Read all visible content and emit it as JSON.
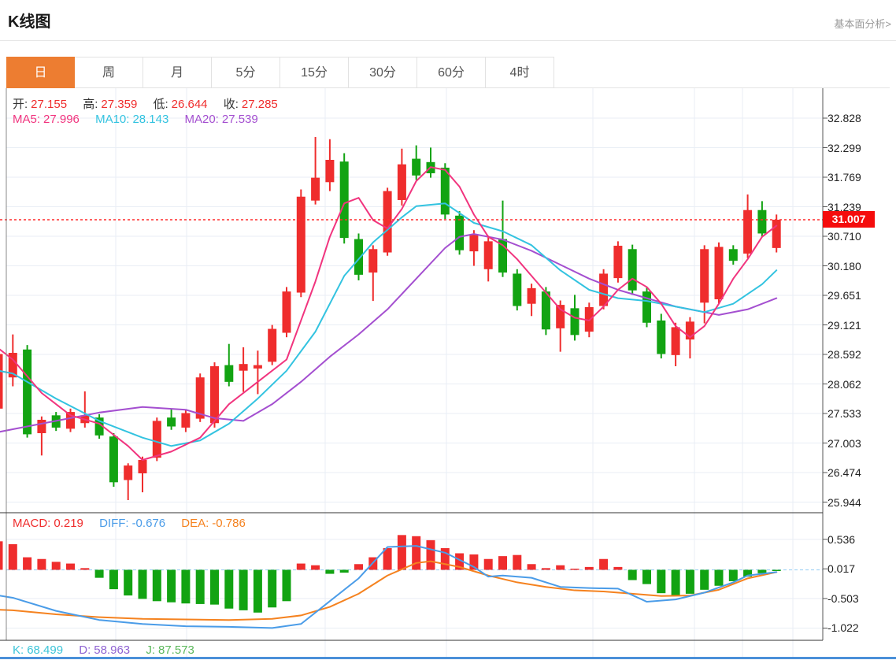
{
  "header": {
    "title": "K线图",
    "link": "基本面分析>"
  },
  "tabs": {
    "items": [
      {
        "label": "日",
        "active": true
      },
      {
        "label": "周",
        "active": false
      },
      {
        "label": "月",
        "active": false
      },
      {
        "label": "5分",
        "active": false
      },
      {
        "label": "15分",
        "active": false
      },
      {
        "label": "30分",
        "active": false
      },
      {
        "label": "60分",
        "active": false
      },
      {
        "label": "4时",
        "active": false
      }
    ]
  },
  "ohlc_legend": {
    "open_label": "开:",
    "open": "27.155",
    "high_label": "高:",
    "high": "27.359",
    "low_label": "低:",
    "low": "26.644",
    "close_label": "收:",
    "close": "27.285"
  },
  "ma_legend": {
    "ma5_label": "MA5:",
    "ma5": "27.996",
    "ma10_label": "MA10:",
    "ma10": "28.143",
    "ma20_label": "MA20:",
    "ma20": "27.539"
  },
  "price_axis": {
    "ticks": [
      "32.828",
      "32.299",
      "31.769",
      "31.239",
      "30.710",
      "30.180",
      "29.651",
      "29.121",
      "28.592",
      "28.062",
      "27.533",
      "27.003",
      "26.474",
      "25.944"
    ],
    "current": "31.007"
  },
  "macd_panel": {
    "macd_label": "MACD:",
    "macd": "0.219",
    "diff_label": "DIFF:",
    "diff": "-0.676",
    "dea_label": "DEA:",
    "dea": "-0.786",
    "axis_ticks": [
      "0.536",
      "0.017",
      "-0.503",
      "-1.022"
    ]
  },
  "kdj_legend": {
    "k_label": "K:",
    "k": "68.499",
    "d_label": "D:",
    "d": "58.963",
    "j_label": "J:",
    "j": "87.573"
  },
  "colors": {
    "up": "#ef2d2d",
    "down": "#12a312",
    "ma5": "#f1347e",
    "ma10": "#33c3e0",
    "ma20": "#a44fd0",
    "diff": "#4a9ce8",
    "dea": "#f5821f",
    "tab_accent": "#ed7d31",
    "current_line": "#ff2b2b",
    "current_tag_bg": "#f50c0c",
    "grid": "#e9eef5",
    "axis": "#555555",
    "panel_border": "#333333",
    "zero_dash": "#a6d4f5",
    "bottom_bar": "#4a90d9"
  },
  "chart_data": {
    "type": "candlestick",
    "title": "K线图 日K + MACD",
    "price_axis_range": [
      25.944,
      32.828
    ],
    "price_ticks": [
      32.828,
      32.299,
      31.769,
      31.239,
      30.71,
      30.18,
      29.651,
      29.121,
      28.592,
      28.062,
      27.533,
      27.003,
      26.474,
      25.944
    ],
    "current_price": 31.007,
    "legend_values": {
      "open": 27.155,
      "high": 27.359,
      "low": 26.644,
      "close": 27.285,
      "ma5": 27.996,
      "ma10": 28.143,
      "ma20": 27.539
    },
    "candles": [
      [
        27.62,
        28.7,
        27.52,
        28.6
      ],
      [
        28.18,
        28.95,
        28.02,
        28.62
      ],
      [
        28.68,
        28.76,
        27.1,
        27.16
      ],
      [
        27.18,
        27.48,
        26.78,
        27.42
      ],
      [
        27.5,
        27.56,
        27.22,
        27.28
      ],
      [
        27.26,
        27.62,
        27.2,
        27.56
      ],
      [
        27.36,
        27.93,
        27.28,
        27.5
      ],
      [
        27.46,
        27.52,
        27.08,
        27.14
      ],
      [
        27.12,
        27.18,
        26.22,
        26.3
      ],
      [
        26.34,
        26.64,
        25.98,
        26.6
      ],
      [
        26.46,
        26.76,
        26.12,
        26.7
      ],
      [
        26.74,
        27.46,
        26.68,
        27.4
      ],
      [
        27.46,
        27.62,
        27.24,
        27.3
      ],
      [
        27.28,
        27.6,
        27.2,
        27.54
      ],
      [
        27.44,
        28.25,
        27.38,
        28.18
      ],
      [
        27.36,
        28.45,
        27.28,
        28.38
      ],
      [
        28.4,
        28.78,
        28.02,
        28.1
      ],
      [
        28.3,
        28.72,
        27.92,
        28.42
      ],
      [
        28.34,
        28.66,
        27.88,
        28.4
      ],
      [
        28.46,
        29.12,
        28.4,
        29.05
      ],
      [
        28.98,
        29.8,
        28.9,
        29.72
      ],
      [
        29.7,
        31.55,
        29.62,
        31.42
      ],
      [
        31.35,
        32.49,
        31.28,
        31.76
      ],
      [
        31.68,
        32.45,
        31.52,
        32.08
      ],
      [
        32.05,
        32.2,
        30.58,
        30.68
      ],
      [
        30.66,
        30.76,
        29.92,
        30.02
      ],
      [
        30.06,
        30.55,
        29.55,
        30.48
      ],
      [
        30.42,
        31.58,
        30.36,
        31.52
      ],
      [
        31.36,
        32.28,
        31.26,
        32.0
      ],
      [
        32.1,
        32.34,
        31.72,
        31.8
      ],
      [
        32.04,
        32.3,
        31.76,
        31.84
      ],
      [
        31.94,
        32.02,
        31.02,
        31.1
      ],
      [
        31.08,
        31.16,
        30.38,
        30.46
      ],
      [
        30.44,
        30.82,
        30.18,
        30.74
      ],
      [
        30.12,
        30.72,
        29.9,
        30.62
      ],
      [
        30.66,
        31.35,
        29.98,
        30.06
      ],
      [
        30.04,
        30.12,
        29.38,
        29.46
      ],
      [
        29.5,
        29.86,
        29.28,
        29.78
      ],
      [
        29.72,
        29.8,
        28.94,
        29.04
      ],
      [
        29.06,
        29.56,
        28.64,
        29.48
      ],
      [
        29.42,
        29.66,
        28.84,
        28.94
      ],
      [
        29.0,
        29.52,
        28.9,
        29.44
      ],
      [
        29.46,
        30.12,
        29.4,
        30.04
      ],
      [
        29.96,
        30.62,
        29.88,
        30.54
      ],
      [
        30.48,
        30.56,
        29.66,
        29.74
      ],
      [
        29.72,
        29.8,
        29.08,
        29.16
      ],
      [
        29.2,
        29.32,
        28.52,
        28.6
      ],
      [
        28.58,
        29.16,
        28.38,
        29.08
      ],
      [
        28.86,
        29.26,
        28.52,
        29.18
      ],
      [
        29.52,
        30.55,
        29.15,
        30.48
      ],
      [
        29.58,
        30.6,
        29.5,
        30.52
      ],
      [
        30.48,
        30.55,
        30.2,
        30.27
      ],
      [
        30.4,
        31.46,
        30.32,
        31.18
      ],
      [
        31.18,
        31.34,
        30.7,
        30.76
      ],
      [
        30.5,
        31.1,
        30.42,
        31.007
      ]
    ],
    "ma5_points": [
      [
        0,
        28.7
      ],
      [
        1,
        28.5
      ],
      [
        3,
        27.9
      ],
      [
        5,
        27.5
      ],
      [
        7,
        27.35
      ],
      [
        9,
        26.95
      ],
      [
        10,
        26.7
      ],
      [
        12,
        26.85
      ],
      [
        14,
        27.1
      ],
      [
        16,
        27.7
      ],
      [
        18,
        28.1
      ],
      [
        20,
        28.5
      ],
      [
        21,
        29.2
      ],
      [
        22,
        29.9
      ],
      [
        23,
        30.7
      ],
      [
        24,
        31.3
      ],
      [
        25,
        31.4
      ],
      [
        26,
        31.0
      ],
      [
        27,
        30.85
      ],
      [
        28,
        31.2
      ],
      [
        29,
        31.7
      ],
      [
        30,
        31.95
      ],
      [
        31,
        31.9
      ],
      [
        32,
        31.6
      ],
      [
        33,
        31.1
      ],
      [
        34,
        30.7
      ],
      [
        35,
        30.55
      ],
      [
        36,
        30.3
      ],
      [
        37,
        30.0
      ],
      [
        38,
        29.7
      ],
      [
        39,
        29.4
      ],
      [
        40,
        29.25
      ],
      [
        41,
        29.2
      ],
      [
        42,
        29.45
      ],
      [
        43,
        29.75
      ],
      [
        44,
        29.95
      ],
      [
        45,
        29.8
      ],
      [
        46,
        29.5
      ],
      [
        47,
        29.1
      ],
      [
        48,
        28.9
      ],
      [
        49,
        29.1
      ],
      [
        50,
        29.5
      ],
      [
        51,
        29.95
      ],
      [
        52,
        30.3
      ],
      [
        53,
        30.7
      ],
      [
        54,
        30.9
      ]
    ],
    "ma10_points": [
      [
        0,
        28.3
      ],
      [
        1,
        28.25
      ],
      [
        4,
        27.8
      ],
      [
        7,
        27.4
      ],
      [
        10,
        27.1
      ],
      [
        12,
        26.95
      ],
      [
        14,
        27.05
      ],
      [
        16,
        27.35
      ],
      [
        18,
        27.8
      ],
      [
        20,
        28.3
      ],
      [
        22,
        29.0
      ],
      [
        24,
        30.0
      ],
      [
        26,
        30.6
      ],
      [
        28,
        31.05
      ],
      [
        29,
        31.25
      ],
      [
        31,
        31.3
      ],
      [
        33,
        30.95
      ],
      [
        35,
        30.8
      ],
      [
        37,
        30.55
      ],
      [
        39,
        30.1
      ],
      [
        41,
        29.75
      ],
      [
        43,
        29.6
      ],
      [
        45,
        29.55
      ],
      [
        47,
        29.45
      ],
      [
        49,
        29.35
      ],
      [
        51,
        29.5
      ],
      [
        53,
        29.85
      ],
      [
        54,
        30.1
      ]
    ],
    "ma20_points": [
      [
        0,
        27.2
      ],
      [
        1,
        27.25
      ],
      [
        4,
        27.4
      ],
      [
        7,
        27.55
      ],
      [
        10,
        27.65
      ],
      [
        13,
        27.6
      ],
      [
        15,
        27.45
      ],
      [
        17,
        27.4
      ],
      [
        19,
        27.7
      ],
      [
        21,
        28.1
      ],
      [
        23,
        28.55
      ],
      [
        25,
        28.95
      ],
      [
        27,
        29.4
      ],
      [
        29,
        29.95
      ],
      [
        31,
        30.5
      ],
      [
        32,
        30.7
      ],
      [
        33,
        30.75
      ],
      [
        35,
        30.65
      ],
      [
        37,
        30.45
      ],
      [
        39,
        30.2
      ],
      [
        41,
        29.95
      ],
      [
        43,
        29.75
      ],
      [
        45,
        29.6
      ],
      [
        47,
        29.45
      ],
      [
        49,
        29.35
      ],
      [
        50,
        29.3
      ],
      [
        52,
        29.4
      ],
      [
        54,
        29.6
      ]
    ],
    "macd": {
      "range": [
        -1.022,
        0.536
      ],
      "ticks": [
        0.536,
        0.017,
        -0.503,
        -1.022
      ],
      "histogram": [
        0.5,
        0.45,
        0.22,
        0.19,
        0.14,
        0.11,
        0.03,
        -0.14,
        -0.34,
        -0.45,
        -0.51,
        -0.55,
        -0.57,
        -0.59,
        -0.6,
        -0.61,
        -0.68,
        -0.71,
        -0.75,
        -0.66,
        -0.55,
        0.11,
        0.08,
        -0.07,
        -0.05,
        0.1,
        0.22,
        0.38,
        0.61,
        0.59,
        0.52,
        0.38,
        0.29,
        0.27,
        0.19,
        0.24,
        0.26,
        0.1,
        0.03,
        0.08,
        0.02,
        0.05,
        0.19,
        0.05,
        -0.18,
        -0.25,
        -0.41,
        -0.45,
        -0.42,
        -0.35,
        -0.28,
        -0.2,
        -0.12,
        -0.06,
        -0.02
      ],
      "diff_points": [
        [
          0,
          -0.45
        ],
        [
          1,
          -0.49
        ],
        [
          4,
          -0.72
        ],
        [
          7,
          -0.88
        ],
        [
          10,
          -0.95
        ],
        [
          13,
          -0.99
        ],
        [
          16,
          -1.0
        ],
        [
          19,
          -1.02
        ],
        [
          21,
          -0.95
        ],
        [
          23,
          -0.55
        ],
        [
          25,
          -0.15
        ],
        [
          27,
          0.4
        ],
        [
          29,
          0.42
        ],
        [
          31,
          0.3
        ],
        [
          33,
          0.05
        ],
        [
          34,
          -0.12
        ],
        [
          35,
          -0.1
        ],
        [
          37,
          -0.14
        ],
        [
          39,
          -0.3
        ],
        [
          41,
          -0.32
        ],
        [
          43,
          -0.33
        ],
        [
          45,
          -0.56
        ],
        [
          47,
          -0.52
        ],
        [
          49,
          -0.4
        ],
        [
          51,
          -0.22
        ],
        [
          52,
          -0.1
        ],
        [
          54,
          -0.04
        ]
      ],
      "dea_points": [
        [
          0,
          -0.7
        ],
        [
          1,
          -0.71
        ],
        [
          4,
          -0.78
        ],
        [
          7,
          -0.83
        ],
        [
          10,
          -0.86
        ],
        [
          13,
          -0.87
        ],
        [
          16,
          -0.88
        ],
        [
          19,
          -0.86
        ],
        [
          21,
          -0.8
        ],
        [
          23,
          -0.65
        ],
        [
          25,
          -0.42
        ],
        [
          27,
          -0.1
        ],
        [
          29,
          0.12
        ],
        [
          30,
          0.15
        ],
        [
          32,
          0.05
        ],
        [
          34,
          -0.1
        ],
        [
          36,
          -0.22
        ],
        [
          38,
          -0.3
        ],
        [
          40,
          -0.36
        ],
        [
          42,
          -0.38
        ],
        [
          44,
          -0.42
        ],
        [
          46,
          -0.46
        ],
        [
          48,
          -0.45
        ],
        [
          50,
          -0.35
        ],
        [
          52,
          -0.15
        ],
        [
          54,
          -0.04
        ]
      ]
    }
  }
}
